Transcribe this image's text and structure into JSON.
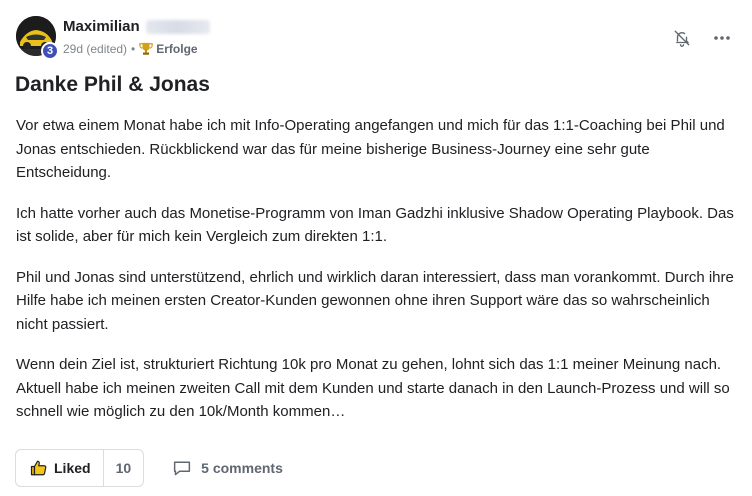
{
  "author": {
    "name": "Maximilian",
    "level": "3"
  },
  "meta": {
    "time": "29d (edited)",
    "separator": "•",
    "category": "Erfolge"
  },
  "post": {
    "title": "Danke Phil & Jonas",
    "paragraphs": [
      "Vor etwa einem Monat habe ich mit Info-Operating angefangen und mich für das 1:1-Coaching bei Phil und Jonas entschieden. Rückblickend war das für meine bisherige Business-Journey eine sehr gute Entscheidung.",
      "Ich hatte vorher auch das Monetise-Programm von Iman Gadzhi inklusive Shadow Operating Playbook. Das ist solide, aber für mich kein Vergleich zum direkten 1:1.",
      "Phil und Jonas sind unterstützend, ehrlich und wirklich daran interessiert, dass man vorankommt. Durch ihre Hilfe habe ich meinen ersten Creator-Kunden gewonnen ohne ihren Support wäre das so wahrscheinlich nicht passiert.",
      "Wenn dein Ziel ist, strukturiert Richtung 10k pro Monat zu gehen, lohnt sich das 1:1 meiner Meinung nach. Aktuell habe ich meinen zweiten Call mit dem Kunden und starte danach in den Launch-Prozess und will so schnell wie möglich zu den 10k/Month kommen…"
    ]
  },
  "actions": {
    "like_label": "Liked",
    "like_count": "10",
    "comments_label": "5 comments"
  },
  "icons": {
    "bell": "bell-off-icon",
    "more": "more-horizontal-icon",
    "trophy": "trophy-icon",
    "like": "thumbs-up-icon",
    "comment": "comment-bubble-icon"
  },
  "colors": {
    "level_badge": "#3f51b5",
    "trophy": "#d4a017",
    "text": "#202124",
    "muted": "#80868b"
  }
}
